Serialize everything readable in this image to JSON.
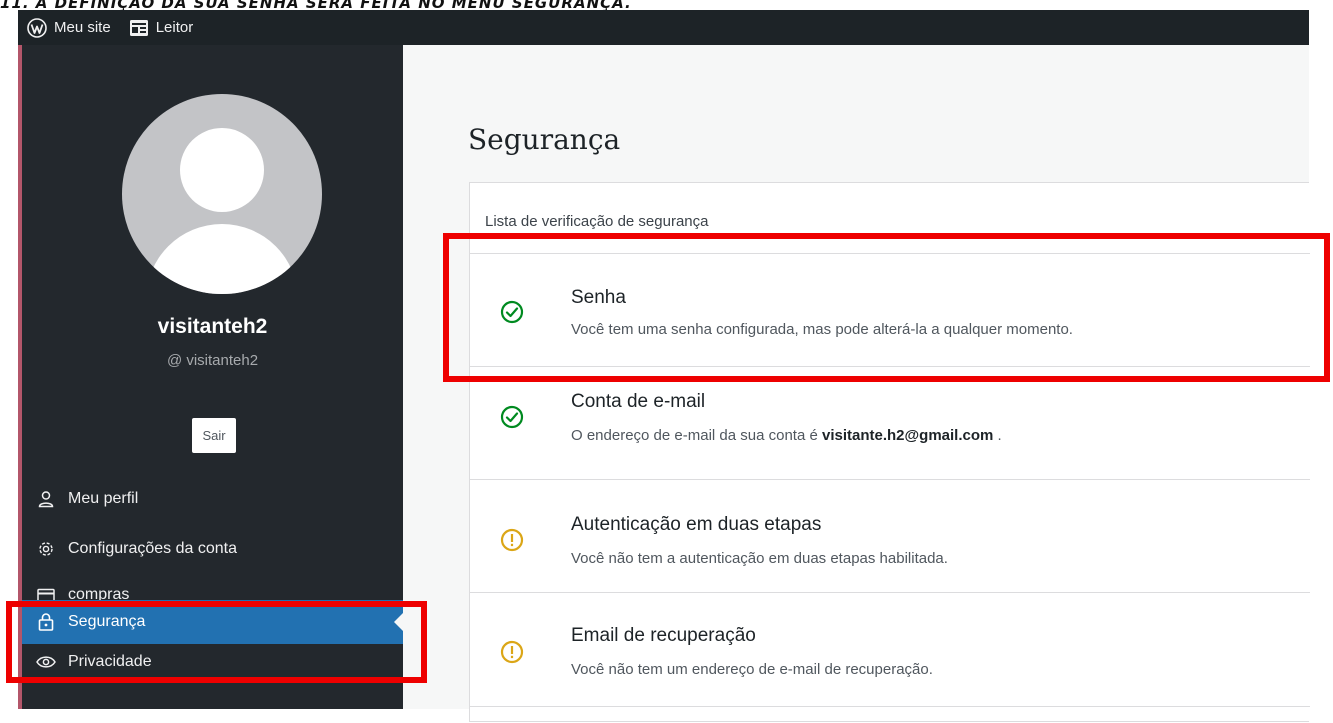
{
  "caption": "11. A DEFINIÇÃO DA SUA SENHA SERÁ FEITA NO MENU SEGURANÇA.",
  "adminbar": {
    "my_site": "Meu site",
    "reader": "Leitor"
  },
  "profile": {
    "display_name": "visitanteh2",
    "handle": "@ visitanteh2",
    "logout_label": "Sair"
  },
  "nav": {
    "items": [
      {
        "label": "Meu perfil",
        "icon": "user-icon"
      },
      {
        "label": "Configurações da conta",
        "icon": "gear-icon"
      },
      {
        "label": "compras",
        "icon": "card-icon"
      },
      {
        "label": "Segurança",
        "icon": "lock-icon",
        "active": true
      },
      {
        "label": "Privacidade",
        "icon": "eye-icon"
      }
    ]
  },
  "main": {
    "title": "Segurança",
    "checklist_heading": "Lista de verificação de segurança",
    "items": [
      {
        "title": "Senha",
        "desc": "Você tem uma senha configurada, mas pode alterá-la a qualquer momento.",
        "status": "ok"
      },
      {
        "title": "Conta de e-mail",
        "desc_prefix": "O endereço de e-mail da sua conta é ",
        "email": "visitante.h2@gmail.com",
        "desc_suffix": " .",
        "status": "ok"
      },
      {
        "title": "Autenticação em duas etapas",
        "desc": "Você não tem a autenticação em duas etapas habilitada.",
        "status": "warning"
      },
      {
        "title": "Email de recuperação",
        "desc": "Você não tem um endereço de e-mail de recuperação.",
        "status": "warning"
      }
    ]
  },
  "colors": {
    "ok": "#008a20",
    "warning": "#dba617",
    "highlight": "#ee0000",
    "active_nav": "#2271b1",
    "sidebar_bg": "#23282d"
  }
}
